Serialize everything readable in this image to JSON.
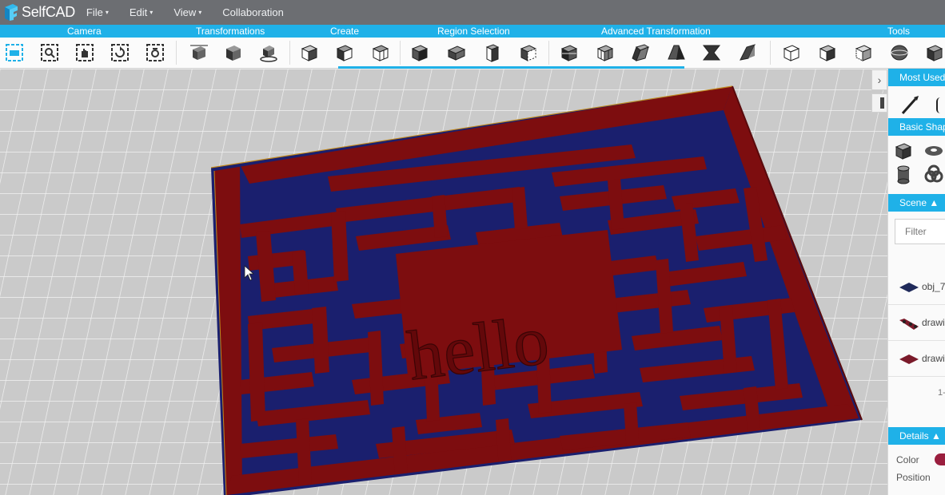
{
  "app": {
    "name": "SelfCAD"
  },
  "menu": {
    "items": [
      {
        "label": "File",
        "caret": "▾"
      },
      {
        "label": "Edit",
        "caret": "▾"
      },
      {
        "label": "View",
        "caret": "▾"
      },
      {
        "label": "Collaboration",
        "caret": ""
      }
    ]
  },
  "toolbar": {
    "groups": [
      {
        "label": "Camera"
      },
      {
        "label": "Transformations"
      },
      {
        "label": "Create"
      },
      {
        "label": "Region Selection"
      },
      {
        "label": "Advanced Transformation"
      },
      {
        "label": "Tools"
      }
    ]
  },
  "viewport": {
    "model_text": "hello",
    "colors": {
      "wall": "#7d0d0f",
      "floor": "#1a1f6e",
      "edge": "#c0881c"
    }
  },
  "panel": {
    "collapse_icon": "chevron-right-icon",
    "most_used": "Most Used",
    "basic_shapes": "Basic Shap",
    "scene": "Scene",
    "scene_caret": "▲",
    "filter_placeholder": "Filter",
    "scene_objects": [
      {
        "label": "obj_7"
      },
      {
        "label": "drawi"
      },
      {
        "label": "drawi"
      }
    ],
    "pager": "1-",
    "details": "Details",
    "details_caret": "▲",
    "color_label": "Color",
    "position_label": "Position"
  },
  "colors": {
    "accent": "#1fb1e8",
    "menubar": "#6c6e72"
  }
}
